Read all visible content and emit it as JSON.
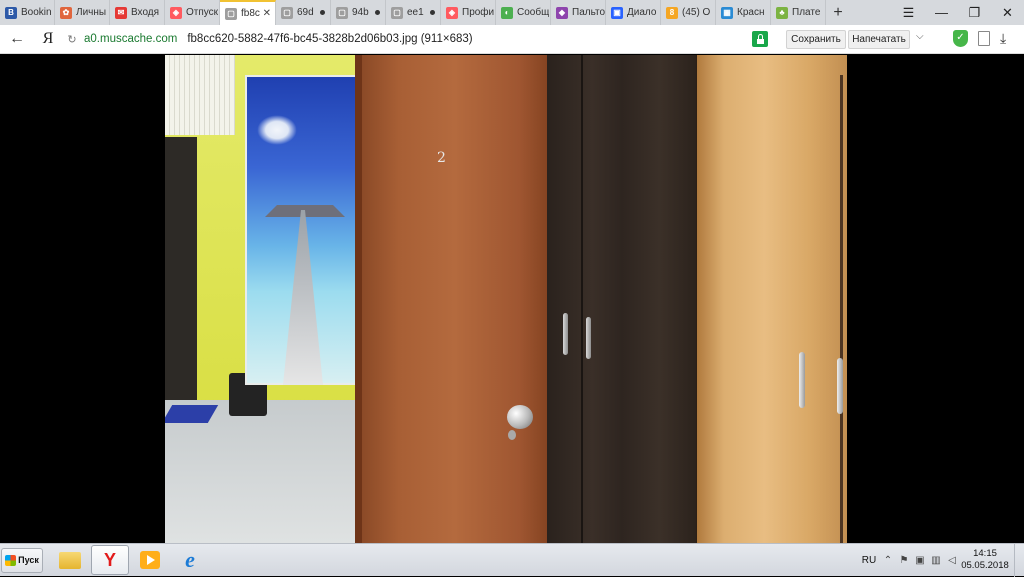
{
  "browser": {
    "tabs": [
      {
        "label": "Bookin",
        "favicon_letter": "B",
        "favicon_color": "#2e5aa8"
      },
      {
        "label": "Личны",
        "favicon_letter": "✿",
        "favicon_color": "#e0663e"
      },
      {
        "label": "Входя",
        "favicon_letter": "✉",
        "favicon_color": "#e53935"
      },
      {
        "label": "Отпуск",
        "favicon_letter": "◈",
        "favicon_color": "#ff5a5f"
      },
      {
        "label": "fb8c",
        "favicon_letter": "▢",
        "favicon_color": "#9e9e9e",
        "active": true
      },
      {
        "label": "69d",
        "favicon_letter": "▢",
        "favicon_color": "#9e9e9e"
      },
      {
        "label": "94b",
        "favicon_letter": "▢",
        "favicon_color": "#9e9e9e"
      },
      {
        "label": "ee1",
        "favicon_letter": "▢",
        "favicon_color": "#9e9e9e"
      },
      {
        "label": "Профи",
        "favicon_letter": "◈",
        "favicon_color": "#ff5a5f"
      },
      {
        "label": "Сообщ",
        "favicon_letter": "◐",
        "favicon_color": "#4caf50"
      },
      {
        "label": "Пальто",
        "favicon_letter": "◆",
        "favicon_color": "#8e44ad"
      },
      {
        "label": "Диало",
        "favicon_letter": "▣",
        "favicon_color": "#2962ff"
      },
      {
        "label": "(45) О",
        "favicon_letter": "8",
        "favicon_color": "#f5a623"
      },
      {
        "label": "Красн",
        "favicon_letter": "▦",
        "favicon_color": "#2a8bd4"
      },
      {
        "label": "Плате",
        "favicon_letter": "♣",
        "favicon_color": "#7cb342"
      }
    ],
    "new_tab": "+",
    "window_controls": {
      "menu": "☰",
      "minimize": "—",
      "restore": "❐",
      "close": "✕"
    },
    "address": {
      "back": "←",
      "yandex": "Я",
      "reload": "↻",
      "domain": "a0.muscache.com",
      "path": "fb8cc620-5882-47f6-bc45-3828b2d06b03.jpg (911×683)",
      "save_label": "Сохранить",
      "print_label": "Напечатать",
      "more": "⌵",
      "protect": "✓",
      "download": "⤓"
    }
  },
  "photo": {
    "door_number": "2"
  },
  "taskbar": {
    "start_label": "Пуск",
    "yandex_letter": "Y",
    "ie_letter": "e",
    "lang": "RU",
    "tray_chevron": "⌃",
    "time": "14:15",
    "date": "05.05.2018"
  }
}
